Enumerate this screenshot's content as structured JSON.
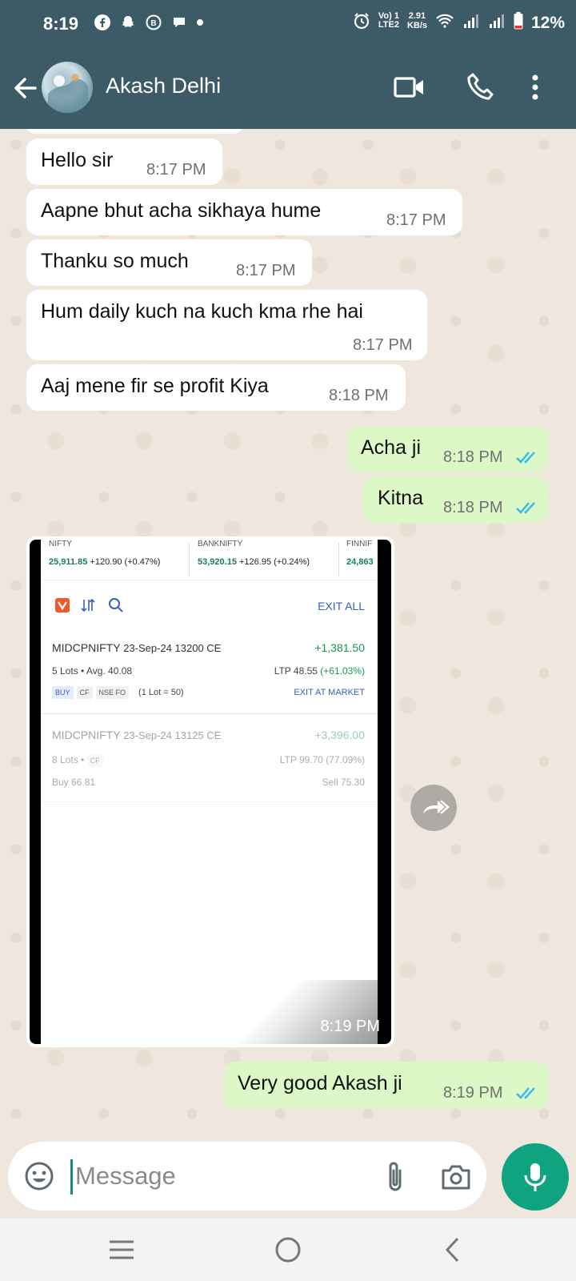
{
  "status_bar": {
    "time": "8:19",
    "network_type_top": "Vo) 1",
    "network_type_bottom": "LTE2",
    "speed_value": "2.91",
    "speed_unit": "KB/s",
    "battery": "12%"
  },
  "header": {
    "contact_name": "Akash Delhi"
  },
  "messages": [
    {
      "direction": "in",
      "text": "Hello sir",
      "time": "8:17 PM"
    },
    {
      "direction": "in",
      "text": "Aapne bhut acha sikhaya hume",
      "time": "8:17 PM"
    },
    {
      "direction": "in",
      "text": "Thanku so much",
      "time": "8:17 PM"
    },
    {
      "direction": "in",
      "text": "Hum daily kuch na kuch kma rhe hai",
      "time": "8:17 PM"
    },
    {
      "direction": "in",
      "text": "Aaj mene fir se profit Kiya",
      "time": "8:18 PM"
    },
    {
      "direction": "out",
      "text": "Acha ji",
      "time": "8:18 PM",
      "status": "read"
    },
    {
      "direction": "out",
      "text": "Kitna",
      "time": "8:18 PM",
      "status": "read"
    },
    {
      "direction": "out",
      "text": "Very good Akash ji",
      "time": "8:19 PM",
      "status": "read"
    }
  ],
  "image_message": {
    "time": "8:19 PM",
    "indices": [
      {
        "name": "NIFTY",
        "value": "25,911.85",
        "change": "+120.90 (+0.47%)"
      },
      {
        "name": "BANKNIFTY",
        "value": "53,920.15",
        "change": "+126.95 (+0.24%)"
      },
      {
        "name": "FINNIF",
        "value": "24,863",
        "change": ""
      }
    ],
    "exit_all": "EXIT ALL",
    "positions": [
      {
        "instrument": "MIDCPNIFTY",
        "contract": "23-Sep-24 13200 CE",
        "pnl": "+1,381.50",
        "lots": "5 Lots",
        "avg": "Avg. 40.08",
        "ltp": "LTP 48.55",
        "ltp_change": "(+61.03%)",
        "tags": [
          "BUY",
          "CF",
          "NSE FO"
        ],
        "lot_size": "(1 Lot = 50)",
        "action": "EXIT AT MARKET"
      },
      {
        "instrument": "MIDCPNIFTY",
        "contract": "23-Sep-24 13125 CE",
        "pnl": "+3,396.00",
        "lots": "8  Lots",
        "cf": "CF",
        "ltp": "LTP 99.70 (77.09%)",
        "buy": "Buy 66.81",
        "sell": "Sell 75.30"
      }
    ]
  },
  "composer": {
    "placeholder": "Message"
  },
  "colors": {
    "header_bg": "#3d5b66",
    "chat_bg": "#efe7de",
    "outgoing_bubble": "#dcf8c6",
    "incoming_bubble": "#ffffff",
    "read_ticks": "#34b7f1",
    "mic_button": "#0fa37f"
  }
}
